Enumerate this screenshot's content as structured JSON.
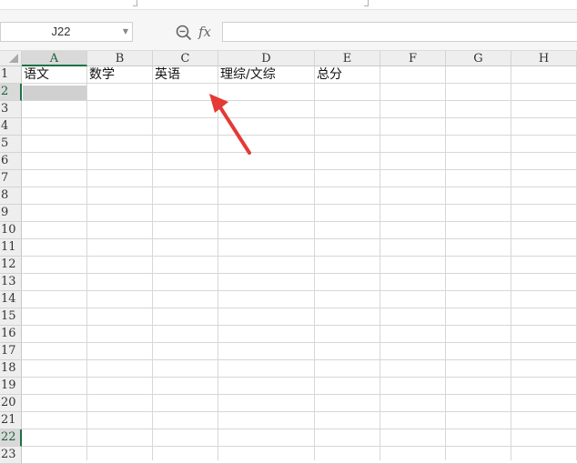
{
  "name_box": {
    "value": "J22"
  },
  "formula_bar": {
    "fx_label": "fx",
    "content": ""
  },
  "columns": [
    "A",
    "B",
    "C",
    "D",
    "E",
    "F",
    "G",
    "H"
  ],
  "rows": [
    "1",
    "2",
    "3",
    "4",
    "5",
    "6",
    "7",
    "8",
    "9",
    "10",
    "11",
    "12",
    "13",
    "14",
    "15",
    "16",
    "17",
    "18",
    "19",
    "20",
    "21",
    "22",
    "23"
  ],
  "cells": {
    "A1": "语文",
    "B1": "数学",
    "C1": "英语",
    "D1": "理综/文综",
    "E1": "总分"
  },
  "active_column": "A",
  "active_rows": [
    "2",
    "22"
  ],
  "colors": {
    "accent": "#1e7145",
    "annotation_arrow": "#e53935",
    "header_bg": "#eeeeee",
    "gridline": "#d7d7d7"
  },
  "icons": {
    "zoom": "zoom-icon",
    "name_box_dropdown": "chevron-down-icon"
  }
}
